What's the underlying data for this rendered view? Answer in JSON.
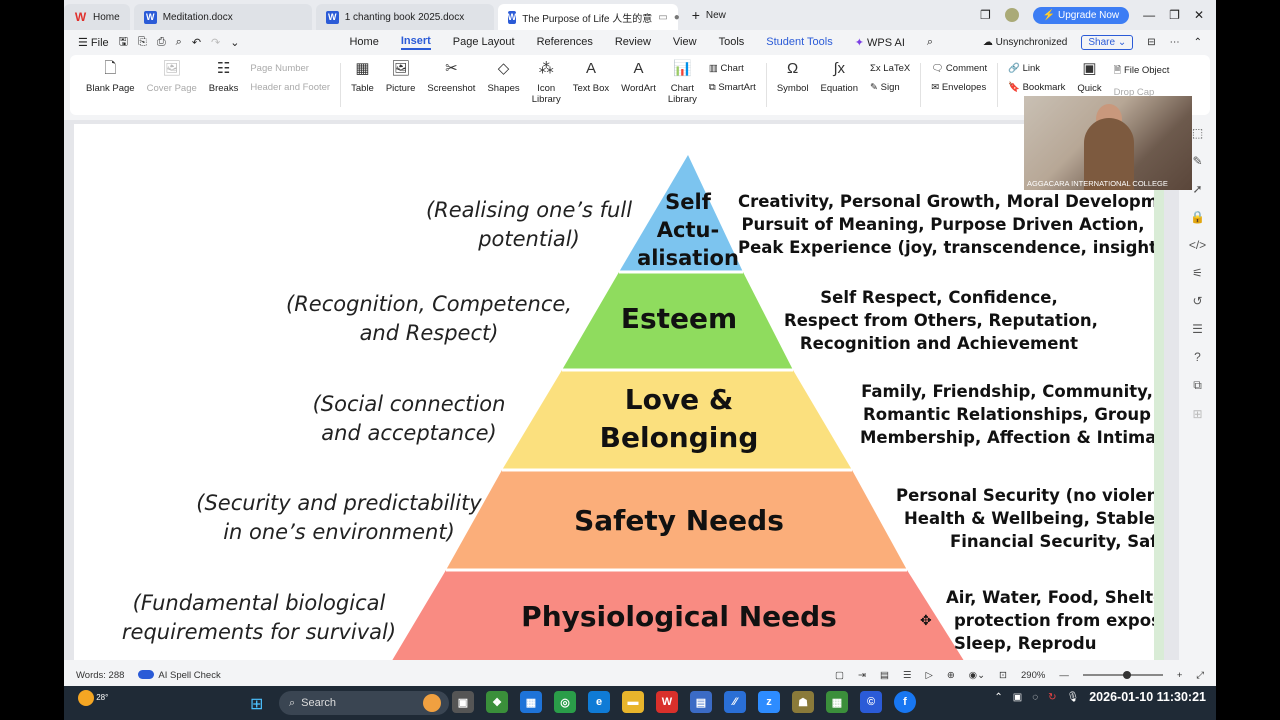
{
  "tabs": [
    {
      "label": "Home",
      "icon": "wps-logo-icon"
    },
    {
      "label": "Meditation.docx",
      "icon": "word-doc-icon"
    },
    {
      "label": "1 chanting book 2025.docx",
      "icon": "word-doc-icon"
    },
    {
      "label": "The Purpose of Life 人生的意",
      "icon": "word-doc-icon",
      "active": true
    }
  ],
  "new_tab_label": "New",
  "upgrade_label": "Upgrade Now",
  "menubar": {
    "file_label": "File",
    "items": [
      "Home",
      "Insert",
      "Page Layout",
      "References",
      "Review",
      "View",
      "Tools",
      "Student Tools"
    ],
    "active": "Insert",
    "ai_label": "WPS AI",
    "sync_label": "Unsynchronized",
    "share_label": "Share"
  },
  "ribbon": {
    "blank_page": "Blank Page",
    "cover_page": "Cover Page",
    "breaks": "Breaks",
    "page_number": "Page Number",
    "header_footer": "Header and Footer",
    "table": "Table",
    "picture": "Picture",
    "screenshot": "Screenshot",
    "shapes": "Shapes",
    "icon_library_1": "Icon",
    "icon_library_2": "Library",
    "text_box": "Text Box",
    "wordart": "WordArt",
    "chart_library_1": "Chart",
    "chart_library_2": "Library",
    "chart": "Chart",
    "smartart": "SmartArt",
    "symbol": "Symbol",
    "equation": "Equation",
    "latex": "LaTeX",
    "sign": "Sign",
    "comment": "Comment",
    "envelopes": "Envelopes",
    "link": "Link",
    "bookmark": "Bookmark",
    "quick": "Quick",
    "file_object": "File Object",
    "drop_cap": "Drop Cap"
  },
  "pyramid": {
    "levels": [
      {
        "label_lines": [
          "Self",
          "Actu-",
          "alisation"
        ],
        "color": "#7cc4ef",
        "left_note": [
          "(Realising one’s full",
          "potential)"
        ],
        "right_note": [
          "Creativity, Personal Growth, Moral Development,",
          "Pursuit of Meaning, Purpose Driven Action,",
          "Peak Experience (joy, transcendence, insight)"
        ]
      },
      {
        "label_lines": [
          "Esteem"
        ],
        "color": "#8fdc5e",
        "left_note": [
          "(Recognition, Competence,",
          "and Respect)"
        ],
        "right_note": [
          "Self Respect, Confidence,",
          "Respect from Others, Reputation,",
          "Recognition and Achievement"
        ]
      },
      {
        "label_lines": [
          "Love &",
          "Belonging"
        ],
        "color": "#fbe07e",
        "left_note": [
          "(Social connection",
          "and acceptance)"
        ],
        "right_note": [
          "Family, Friendship, Community,",
          "Romantic Relationships, Group",
          "Membership, Affection & Intimacy"
        ]
      },
      {
        "label_lines": [
          "Safety Needs"
        ],
        "color": "#fbae7a",
        "left_note": [
          "(Security and predictability",
          "in one’s environment)"
        ],
        "right_note": [
          "Personal Security (no violence,",
          "Health & Wellbeing, Stable En",
          "Financial Security, Safety"
        ]
      },
      {
        "label_lines": [
          "Physiological Needs"
        ],
        "color": "#f98b82",
        "left_note": [
          "(Fundamental biological",
          "requirements for survival)"
        ],
        "right_note": [
          "Air, Water, Food, Shelter",
          "protection from exposu",
          "Sleep, Reprodu"
        ]
      }
    ]
  },
  "video_caption": "AGGACARA INTERNATIONAL COLLEGE",
  "status": {
    "words": "Words: 288",
    "spell_check": "AI Spell Check",
    "zoom": "290%"
  },
  "taskbar": {
    "temperature": "28°",
    "search_placeholder": "Search",
    "clock": "2026-01-10  11:30:21"
  }
}
